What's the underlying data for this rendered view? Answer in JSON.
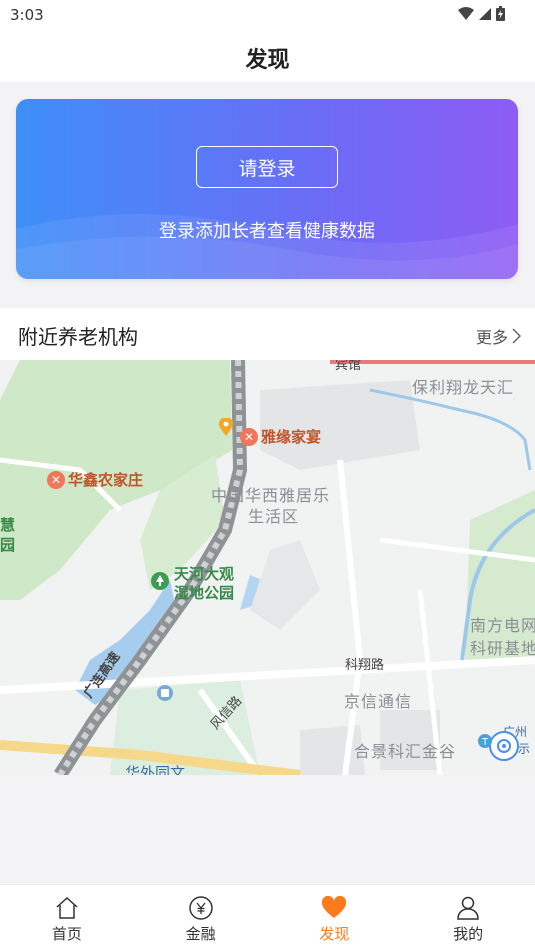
{
  "status_bar": {
    "time": "3:03"
  },
  "header": {
    "title": "发现"
  },
  "login_card": {
    "button_label": "请登录",
    "description": "登录添加长者查看健康数据"
  },
  "nearby": {
    "title": "附近养老机构",
    "more_label": "更多"
  },
  "map": {
    "labels": {
      "top_cut": "宾馆",
      "baoli": "保利翔龙天汇",
      "yayuan": "雅缘家宴",
      "huaxi": "中国华西雅居乐",
      "shenghuo": "生活区",
      "huaxin": "华鑫农家庄",
      "hui": "慧",
      "yuan": "园",
      "tianhe1": "天河大观",
      "tianhe2": "湿地公园",
      "nanfang1": "南方电网",
      "nanfang2": "科研基地",
      "kexiang": "科翔路",
      "jingxin": "京信通信",
      "guanglian": "广连高速",
      "fengxin": "风信路",
      "hejing": "合景科汇金谷",
      "huawai": "华外同文",
      "guangzhou": "广州",
      "shi": "示"
    }
  },
  "tabs": [
    {
      "label": "首页",
      "icon": "home-icon"
    },
    {
      "label": "金融",
      "icon": "yuan-icon"
    },
    {
      "label": "发现",
      "icon": "heart-icon"
    },
    {
      "label": "我的",
      "icon": "user-icon"
    }
  ],
  "colors": {
    "accent": "#ff7a1a",
    "card_start": "#3e8ff8",
    "card_end": "#8e5cf5"
  }
}
